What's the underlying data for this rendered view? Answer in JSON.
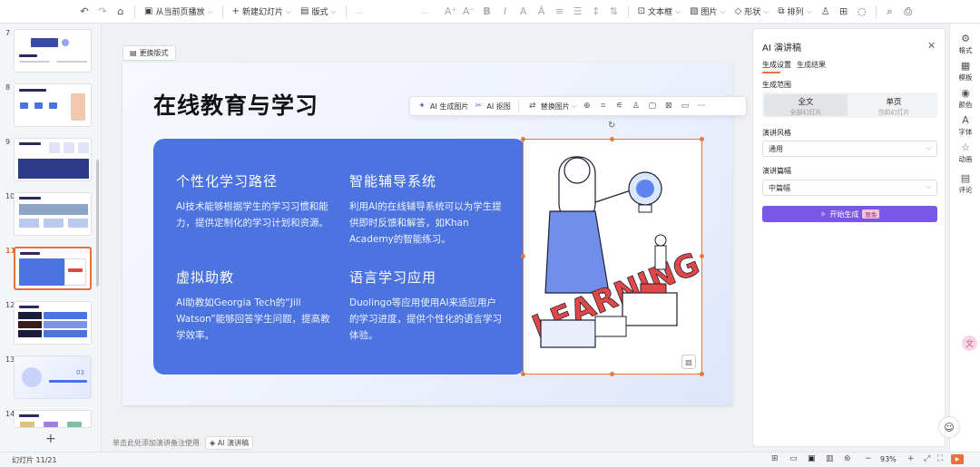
{
  "toolbar": {
    "play_from_current": "从当前页播放",
    "new_slide": "新建幻灯片",
    "layout": "版式",
    "font_name": "...",
    "text_box": "文本框",
    "picture": "图片",
    "shape": "形状",
    "arrange": "排列",
    "icons": {
      "undo": "undo-icon",
      "redo": "redo-icon",
      "search": "search-icon",
      "print": "print-icon"
    }
  },
  "thumbnails": [
    {
      "num": "7"
    },
    {
      "num": "8"
    },
    {
      "num": "9"
    },
    {
      "num": "10"
    },
    {
      "num": "11"
    },
    {
      "num": "12"
    },
    {
      "num": "13"
    },
    {
      "num": "14"
    }
  ],
  "thumb13_number": "03",
  "active_thumbnail": "11",
  "canvas": {
    "change_layout": "更换版式",
    "notes_placeholder": "单击此处添加演讲备注使用",
    "notes_ai": "AI 演讲稿"
  },
  "slide": {
    "title": "在线教育与学习",
    "features": [
      {
        "title": "个性化学习路径",
        "body": "AI技术能够根据学生的学习习惯和能力，提供定制化的学习计划和资源。"
      },
      {
        "title": "智能辅导系统",
        "body": "利用AI的在线辅导系统可以为学生提供即时反馈和解答，如Khan Academy的智能练习。"
      },
      {
        "title": "虚拟助教",
        "body": "AI助教如Georgia Tech的“Jill Watson”能够回答学生问题，提高教学效率。"
      },
      {
        "title": "语言学习应用",
        "body": "Duolingo等应用使用AI来适应用户的学习进度，提供个性化的语言学习体验。"
      }
    ],
    "image_text": "LEARNING"
  },
  "image_toolbar": {
    "ai_generate": "AI 生成图片",
    "ai_cutout": "AI 抠图",
    "replace": "替换图片"
  },
  "ai_panel": {
    "title": "AI 演讲稿",
    "tab_settings": "生成设置",
    "tab_results": "生成结果",
    "range_label": "生成范围",
    "range_full": "全文",
    "range_full_sub": "全部幻灯片",
    "range_single": "单页",
    "range_single_sub": "当前幻灯片",
    "style_label": "演讲风格",
    "style_value": "通用",
    "length_label": "演讲篇幅",
    "length_value": "中篇幅",
    "generate": "开始生成",
    "badge": "限免"
  },
  "rail": [
    "格式",
    "模板",
    "颜色",
    "字体",
    "动画",
    "评论"
  ],
  "status": {
    "slide_count": "幻灯片 11/21",
    "zoom": "93%"
  },
  "colors": {
    "accent": "#e8703a",
    "panel_blue": "#4c74e0",
    "ai_purple": "#7b57e6"
  }
}
